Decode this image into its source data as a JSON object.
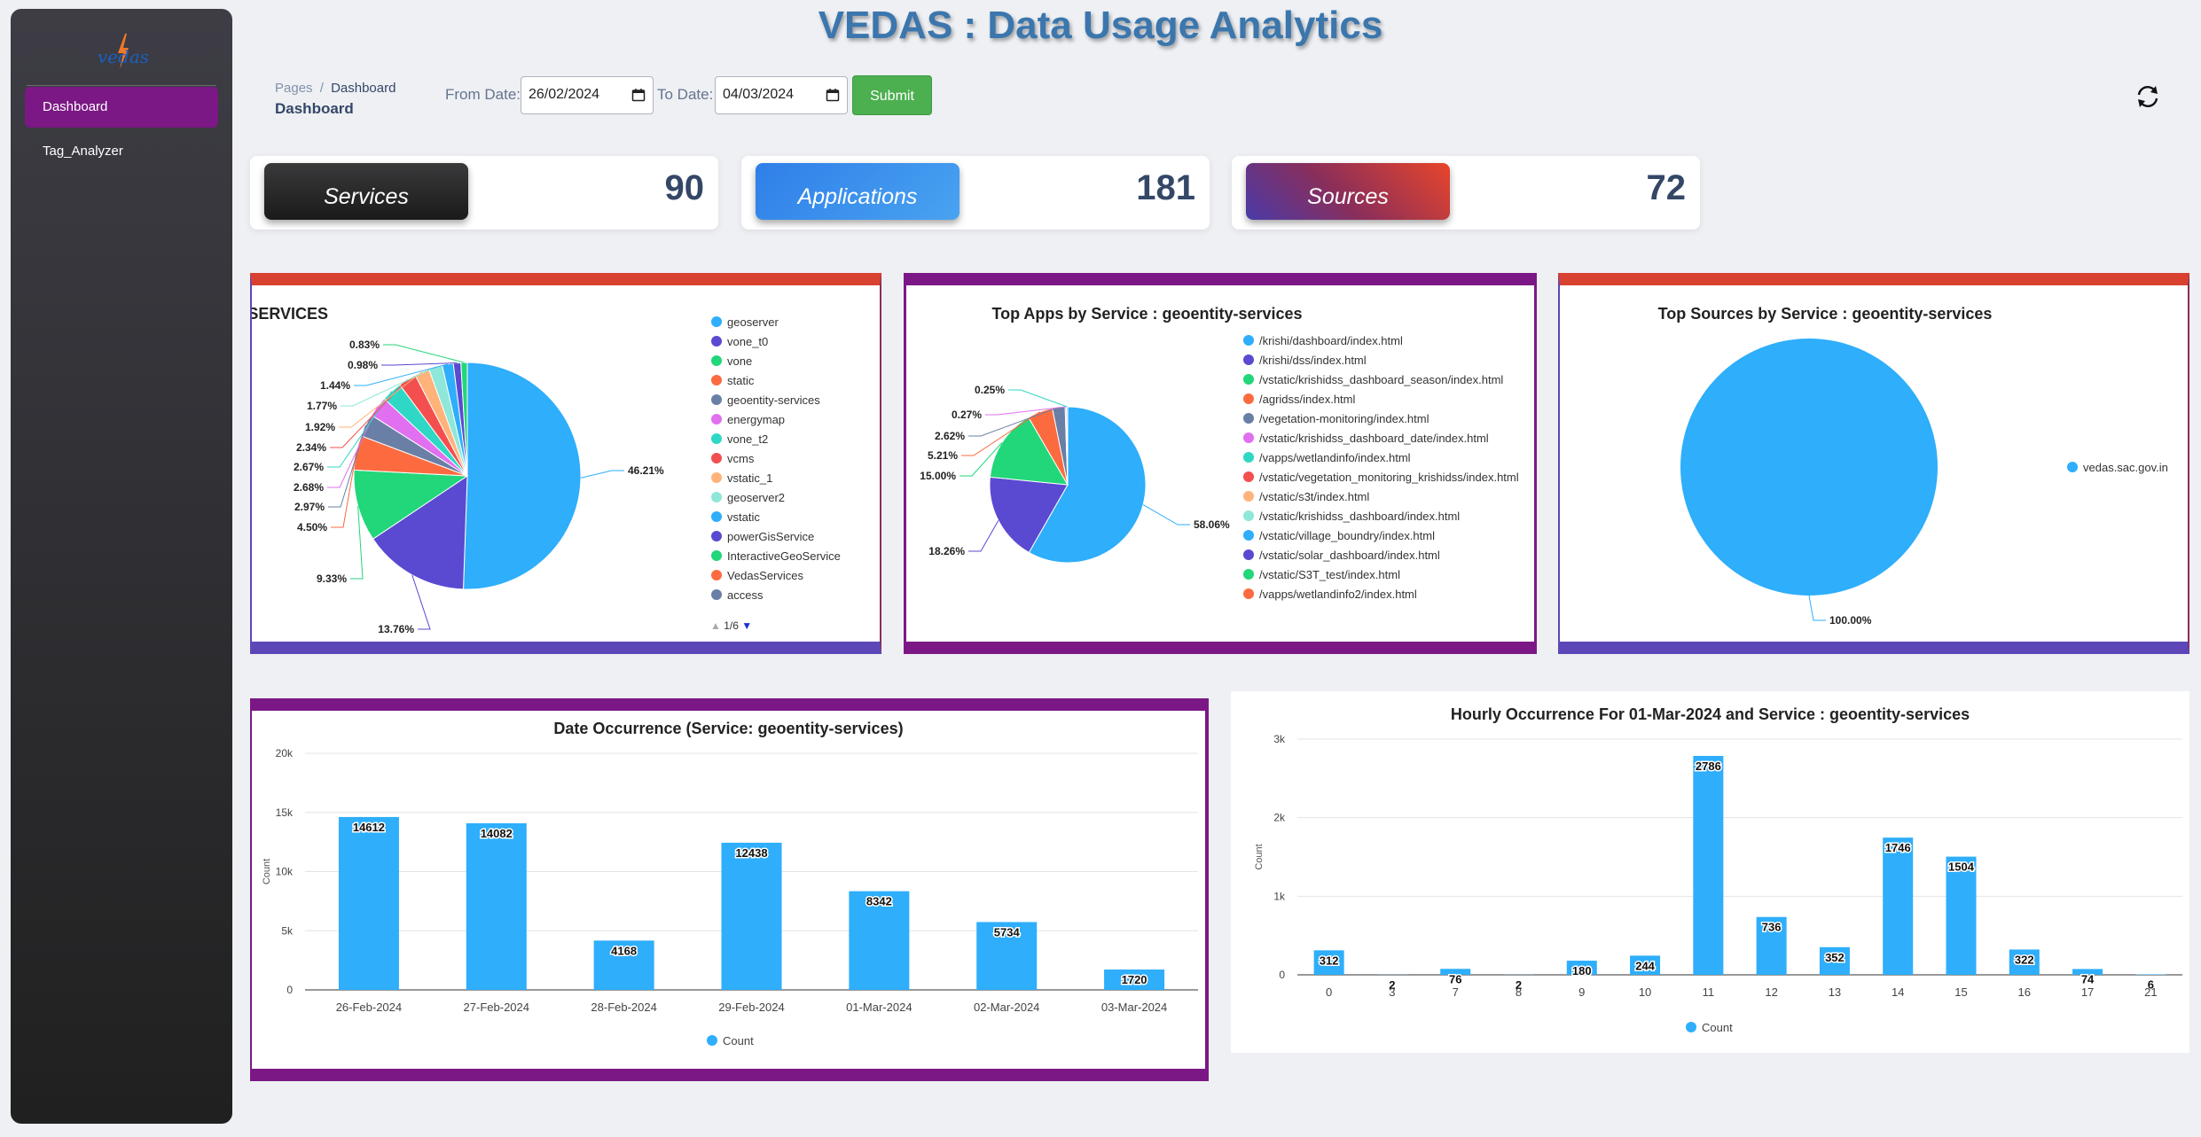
{
  "app": {
    "title": "VEDAS : Data Usage Analytics",
    "logo_text": "vedas"
  },
  "sidebar": {
    "items": [
      {
        "label": "Dashboard"
      },
      {
        "label": "Tag_Analyzer"
      }
    ]
  },
  "breadcrumb": {
    "root": "Pages",
    "separator": "/",
    "current": "Dashboard"
  },
  "page_title": "Dashboard",
  "filters": {
    "from_label": "From Date:",
    "from_value": "26/02/2024",
    "to_label": "To Date:",
    "to_value": "04/03/2024",
    "submit_label": "Submit"
  },
  "stats": [
    {
      "label": "Services",
      "value": "90"
    },
    {
      "label": "Applications",
      "value": "181"
    },
    {
      "label": "Sources",
      "value": "72"
    }
  ],
  "colors": {
    "accent_purple": "#7b1885",
    "bar_blue": "#2eaefb",
    "series": [
      "#2eaefb",
      "#5a4ad1",
      "#22d67a",
      "#fc6b3f",
      "#6a7fa5",
      "#e070f0",
      "#2ed8c4",
      "#f34f4f",
      "#ffb37a",
      "#8ee7d8"
    ]
  },
  "icons": {
    "calendar": "calendar-icon",
    "refresh": "refresh-icon",
    "logo": "vedas-logo-icon"
  },
  "chart_data": [
    {
      "type": "pie",
      "title": "TOP SERVICES",
      "legend": [
        "geoserver",
        "vone_t0",
        "vone",
        "static",
        "geoentity-services",
        "energymap",
        "vone_t2",
        "vcms",
        "vstatic_1",
        "geoserver2",
        "vstatic",
        "powerGisService",
        "InteractiveGeoService",
        "VedasServices",
        "access"
      ],
      "legend_page": "1/6",
      "slices": [
        46.21,
        13.76,
        9.33,
        4.5,
        2.97,
        2.68,
        2.67,
        2.34,
        1.92,
        1.77,
        1.44,
        0.98,
        0.83
      ],
      "labels": [
        "46.21%",
        "13.76%",
        "9.33%",
        "4.50%",
        "2.97%",
        "2.68%",
        "2.67%",
        "2.34%",
        "1.92%",
        "1.77%",
        "1.44%",
        "0.98%",
        "0.83%"
      ]
    },
    {
      "type": "pie",
      "title": "Top Apps by Service : geoentity-services",
      "legend": [
        "/krishi/dashboard/index.html",
        "/krishi/dss/index.html",
        "/vstatic/krishidss_dashboard_season/index.html",
        "/agridss/index.html",
        "/vegetation-monitoring/index.html",
        "/vstatic/krishidss_dashboard_date/index.html",
        "/vapps/wetlandinfo/index.html",
        "/vstatic/vegetation_monitoring_krishidss/index.html",
        "/vstatic/s3t/index.html",
        "/vstatic/krishidss_dashboard/index.html",
        "/vstatic/village_boundry/index.html",
        "/vstatic/solar_dashboard/index.html",
        "/vstatic/S3T_test/index.html",
        "/vapps/wetlandinfo2/index.html"
      ],
      "slices": [
        58.06,
        18.26,
        15.0,
        5.21,
        2.62,
        0.27,
        0.25
      ],
      "labels": [
        "58.06%",
        "18.26%",
        "15.00%",
        "5.21%",
        "2.62%",
        "0.27%",
        "0.25%"
      ]
    },
    {
      "type": "pie",
      "title": "Top Sources by Service : geoentity-services",
      "legend": [
        "vedas.sac.gov.in"
      ],
      "slices": [
        100.0
      ],
      "labels": [
        "100.00%"
      ]
    },
    {
      "type": "bar",
      "title": "Date Occurrence (Service: geoentity-services)",
      "ylabel": "Count",
      "ylim": [
        0,
        20000
      ],
      "yticks": [
        "0",
        "5k",
        "10k",
        "15k",
        "20k"
      ],
      "categories": [
        "26-Feb-2024",
        "27-Feb-2024",
        "28-Feb-2024",
        "29-Feb-2024",
        "01-Mar-2024",
        "02-Mar-2024",
        "03-Mar-2024"
      ],
      "values": [
        14612,
        14082,
        4168,
        12438,
        8342,
        5734,
        1720
      ],
      "series": [
        {
          "name": "Count"
        }
      ]
    },
    {
      "type": "bar",
      "title": "Hourly Occurrence For 01-Mar-2024 and Service : geoentity-services",
      "ylabel": "Count",
      "ylim": [
        0,
        3000
      ],
      "yticks": [
        "0",
        "1k",
        "2k",
        "3k"
      ],
      "categories": [
        "0",
        "3",
        "7",
        "8",
        "9",
        "10",
        "11",
        "12",
        "13",
        "14",
        "15",
        "16",
        "17",
        "21"
      ],
      "values": [
        312,
        2,
        76,
        2,
        180,
        244,
        2786,
        736,
        352,
        1746,
        1504,
        322,
        74,
        6
      ],
      "series": [
        {
          "name": "Count"
        }
      ]
    }
  ]
}
